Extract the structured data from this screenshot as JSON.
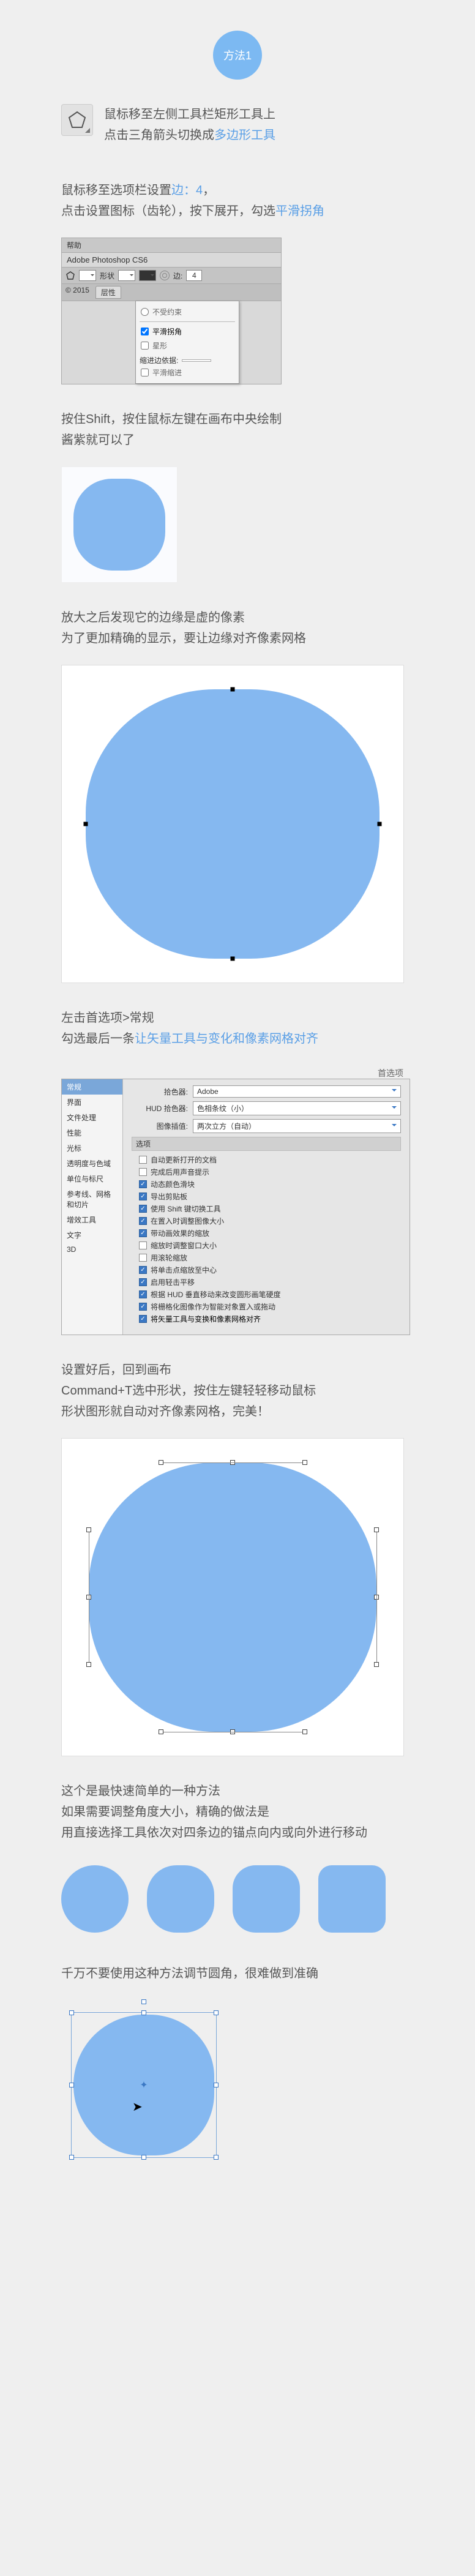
{
  "method_badge": "方法1",
  "step1": {
    "line1": "鼠标移至左侧工具栏矩形工具上",
    "line2_a": "点击三角箭头切换成",
    "line2_b": "多边形工具"
  },
  "step2": {
    "line1_a": "鼠标移至选项栏设置",
    "line1_b": "边：4",
    "line1_c": "，",
    "line2_a": "点击设置图标（齿轮），按下展开，勾选",
    "line2_b": "平滑拐角"
  },
  "ps_bar": {
    "menu": "帮助",
    "title": "Adobe Photoshop CS6",
    "shape_label": "形状",
    "sides_label": "边:",
    "sides_value": "4",
    "tab_year": "© 2015",
    "tab_file": "层性",
    "dropdown": {
      "opt_unconstrained": "不受约束",
      "opt_smooth": "平滑拐角",
      "opt_star": "星形",
      "label_indent": "缩进边依据:",
      "opt_smooth_indent": "平滑缩进"
    }
  },
  "step3": {
    "line1": "按住Shift，按住鼠标左键在画布中央绘制",
    "line2": "酱紫就可以了"
  },
  "step4": {
    "line1": "放大之后发现它的边缘是虚的像素",
    "line2": "为了更加精确的显示，要让边缘对齐像素网格"
  },
  "step5": {
    "line1": "左击首选项>常规",
    "line2_a": "勾选最后一条",
    "line2_b": "让矢量工具与变化和像素网格对齐"
  },
  "prefs": {
    "title": "首选项",
    "side": [
      "常规",
      "界面",
      "文件处理",
      "性能",
      "光标",
      "透明度与色域",
      "单位与标尺",
      "参考线、网格和切片",
      "增效工具",
      "文字",
      "3D"
    ],
    "picker_label": "拾色器:",
    "picker_value": "Adobe",
    "hud_label": "HUD 拾色器:",
    "hud_value": "色相条纹（小）",
    "interp_label": "图像插值:",
    "interp_value": "两次立方（自动）",
    "section": "选项",
    "checks": [
      {
        "on": false,
        "txt": "自动更新打开的文档"
      },
      {
        "on": false,
        "txt": "完成后用声音提示"
      },
      {
        "on": true,
        "txt": "动态颜色滑块"
      },
      {
        "on": true,
        "txt": "导出剪贴板"
      },
      {
        "on": true,
        "txt": "使用 Shift 键切换工具"
      },
      {
        "on": true,
        "txt": "在置入时调整图像大小"
      },
      {
        "on": true,
        "txt": "带动画效果的缩放"
      },
      {
        "on": false,
        "txt": "缩放时调整窗口大小"
      },
      {
        "on": false,
        "txt": "用滚轮缩放"
      },
      {
        "on": true,
        "txt": "将单击点缩放至中心"
      },
      {
        "on": true,
        "txt": "启用轻击平移"
      },
      {
        "on": true,
        "txt": "根据 HUD 垂直移动来改变圆形画笔硬度"
      },
      {
        "on": true,
        "txt": "将栅格化图像作为智能对象置入或拖动"
      },
      {
        "on": true,
        "txt": "将矢量工具与变换和像素网格对齐",
        "hl": true
      }
    ]
  },
  "step6": {
    "line1": "设置好后，回到画布",
    "line2": "Command+T选中形状，按住左键轻轻移动鼠标",
    "line3": "形状图形就自动对齐像素网格，完美！"
  },
  "step7": {
    "line1": "这个是最快速简单的一种方法",
    "line2": "如果需要调整角度大小，精确的做法是",
    "line3": "用直接选择工具依次对四条边的锚点向内或向外进行移动"
  },
  "step8": "千万不要使用这种方法调节圆角，很难做到准确"
}
